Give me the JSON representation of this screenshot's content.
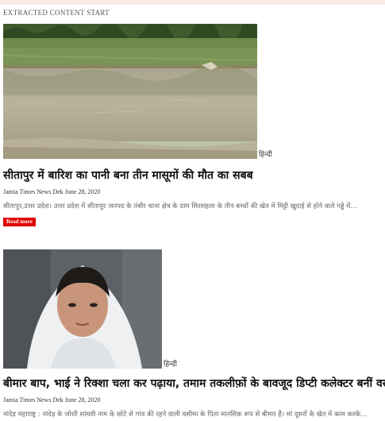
{
  "page": {
    "extracted_label": "EXTRACTED CONTENT START"
  },
  "articles": [
    {
      "category": "हिन्दी",
      "title": "सीतापुर में बारिश का पानी बना तीन मासूमों की मौत का सबब",
      "meta": "Jamia Times News Dek June 28, 2020",
      "excerpt": "सीतापुर,उत्तर प्रदेश। उत्तर प्रदेश में सीतापुर जनपद के तंबौर थाना क्षेत्र के ग्राम सिरसहला के तीन बच्चों की खेत में मिट्टी खुदाई से होने वाले गड्ढे में...",
      "read_more": "Read more"
    },
    {
      "category": "हिन्दी",
      "title": "बीमार बाप, भाई ने रिक्शा चला कर पढ़ाया, तमाम तकलीफ़ों के बावजूद डिप्टी कलेक्टर बनीं वसीमा",
      "meta": "Jamia Times News Dek June 28, 2020",
      "excerpt": "नांदेड़ महाराष्ट्र : नांदेड़ के जोशी सांघवी नाम के छोटे से गांव की रहने वाली वसीमा के पिता मानसिक रूप से बीमार हैं। मां दूसरों के खेत में काम करके..."
    }
  ]
}
